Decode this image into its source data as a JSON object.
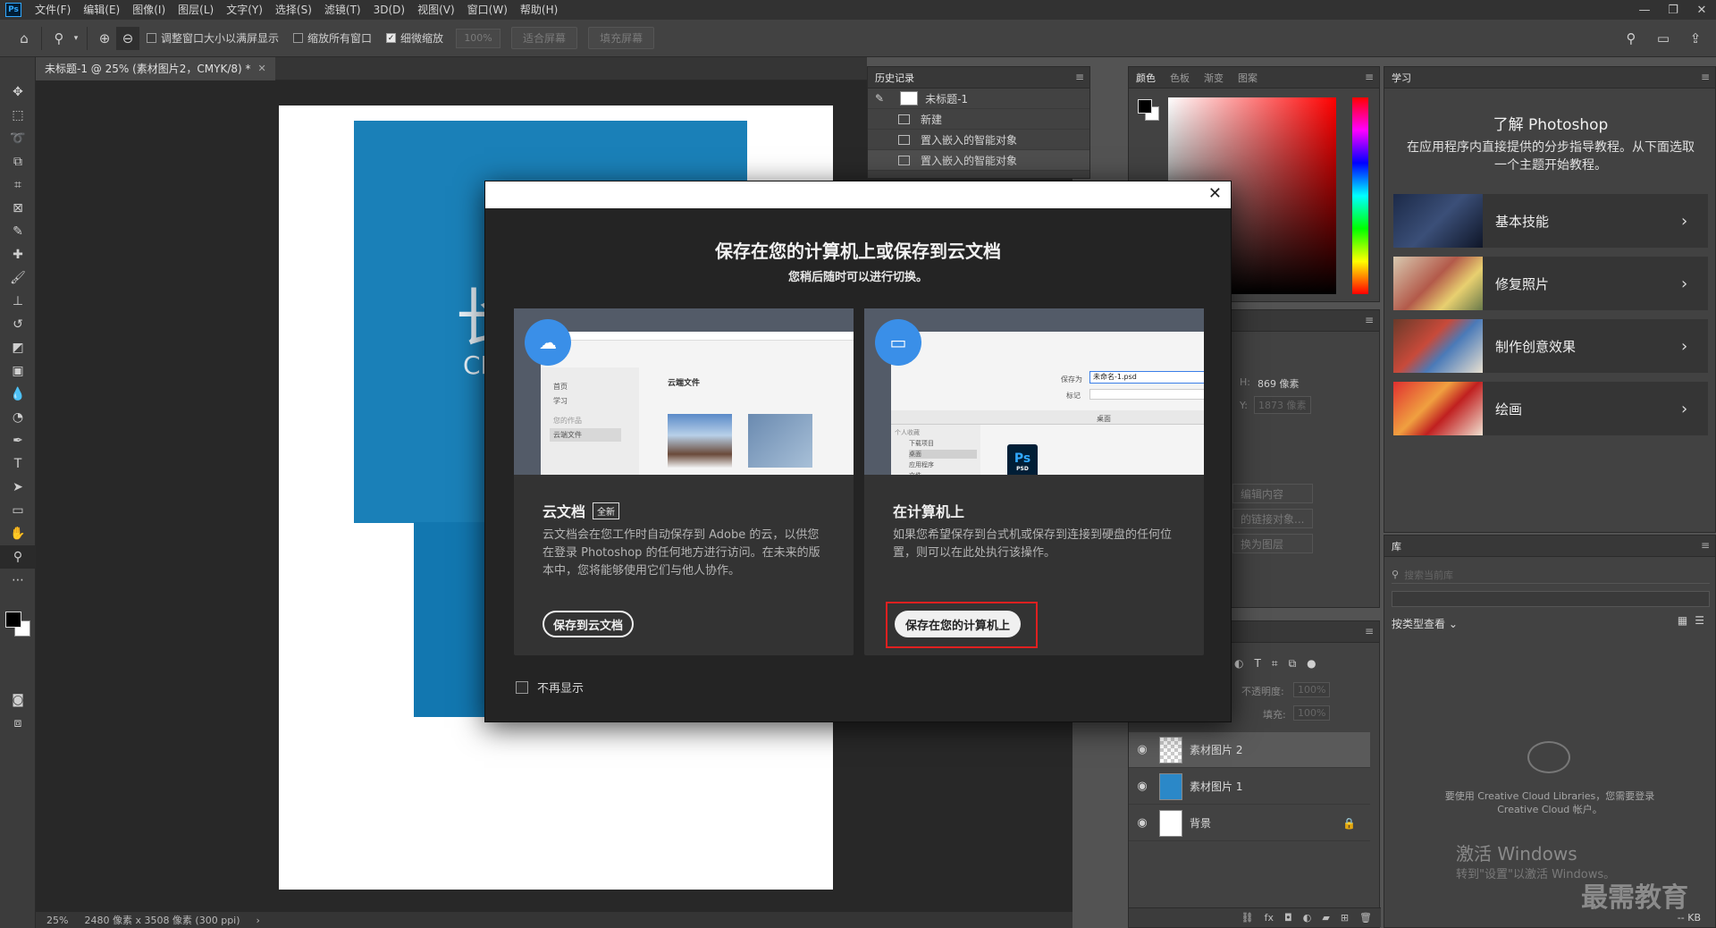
{
  "app": {
    "logo": "Ps",
    "menu": [
      "文件(F)",
      "编辑(E)",
      "图像(I)",
      "图层(L)",
      "文字(Y)",
      "选择(S)",
      "滤镜(T)",
      "3D(D)",
      "视图(V)",
      "窗口(W)",
      "帮助(H)"
    ],
    "window_controls": [
      "—",
      "❐",
      "✕"
    ]
  },
  "options_bar": {
    "check_resize": "调整窗口大小以满屏显示",
    "check_all_windows": "缩放所有窗口",
    "check_scrubby": "细微缩放",
    "zoom_value": "100%",
    "fit_screen": "适合屏幕",
    "fill_screen": "填充屏幕"
  },
  "document": {
    "tab_title": "未标题-1 @ 25% (素材图片2，CMYK/8) *",
    "canvas_text_1": "长",
    "canvas_text_2": "CH",
    "status_zoom": "25%",
    "status_size": "2480 像素 x 3508 像素 (300 ppi)"
  },
  "history_panel": {
    "tab_active": "历史记录",
    "snapshot": "未标题-1",
    "rows": [
      "新建",
      "置入嵌入的智能对象",
      "置入嵌入的智能对象"
    ]
  },
  "color_panel": {
    "tabs": [
      "颜色",
      "色板",
      "渐变",
      "图案"
    ]
  },
  "properties_panel": {
    "h_label": "H:",
    "h_value": "869 像素",
    "y_label": "Y:",
    "y_value": "1873 像素",
    "btn_1": "编辑内容",
    "btn_2": "的链接对象...",
    "btn_3": "换为图层"
  },
  "layers_panel": {
    "opacity_label": "不透明度:",
    "opacity_value": "100%",
    "fill_label": "填充:",
    "fill_value": "100%",
    "layers": [
      {
        "name": "素材图片 2"
      },
      {
        "name": "素材图片 1"
      },
      {
        "name": "背景"
      }
    ]
  },
  "learn_panel": {
    "tab": "学习",
    "title": "了解 Photoshop",
    "description": "在应用程序内直接提供的分步指导教程。从下面选取一个主题开始教程。",
    "cards": [
      "基本技能",
      "修复照片",
      "制作创意效果",
      "绘画"
    ]
  },
  "libraries_panel": {
    "tab": "库",
    "search_placeholder": "搜索当前库",
    "view_label": "按类型查看",
    "message": "要使用 Creative Cloud Libraries，您需要登录 Creative Cloud 帐户。",
    "activate_title": "激活 Windows",
    "activate_sub": "转到\"设置\"以激活 Windows。",
    "watermark": "最需教育",
    "kb": "-- KB"
  },
  "dialog": {
    "heading": "保存在您的计算机上或保存到云文档",
    "subheading": "您稍后随时可以进行切换。",
    "cloud": {
      "title": "云文档",
      "new_badge": "全新",
      "description": "云文档会在您工作时自动保存到 Adobe 的云，以供您在登录 Photoshop 的任何地方进行访问。在未来的版本中，您将能够使用它们与他人协作。",
      "button": "保存到云文档",
      "illus_nav": [
        "首页",
        "学习",
        "您的作品",
        "云端文件"
      ],
      "illus_heading": "云端文件"
    },
    "local": {
      "title": "在计算机上",
      "description": "如果您希望保存到台式机或保存到连接到硬盘的任何位置，则可以在此处执行该操作。",
      "button": "保存在您的计算机上",
      "illus_save_label": "保存为",
      "illus_filename": "未命名-1.psd",
      "illus_tag_label": "标记",
      "illus_location": "桌面",
      "illus_sidebar": [
        "个人收藏",
        "下载项目",
        "桌面",
        "应用程序",
        "文件"
      ],
      "illus_ps": "Ps",
      "illus_psd": "PSD"
    },
    "dont_show": "不再显示"
  },
  "colors": {
    "accent_blue": "#3a8fe8",
    "highlight_red": "#e02020",
    "canvas_blue": "#1a80b8"
  }
}
